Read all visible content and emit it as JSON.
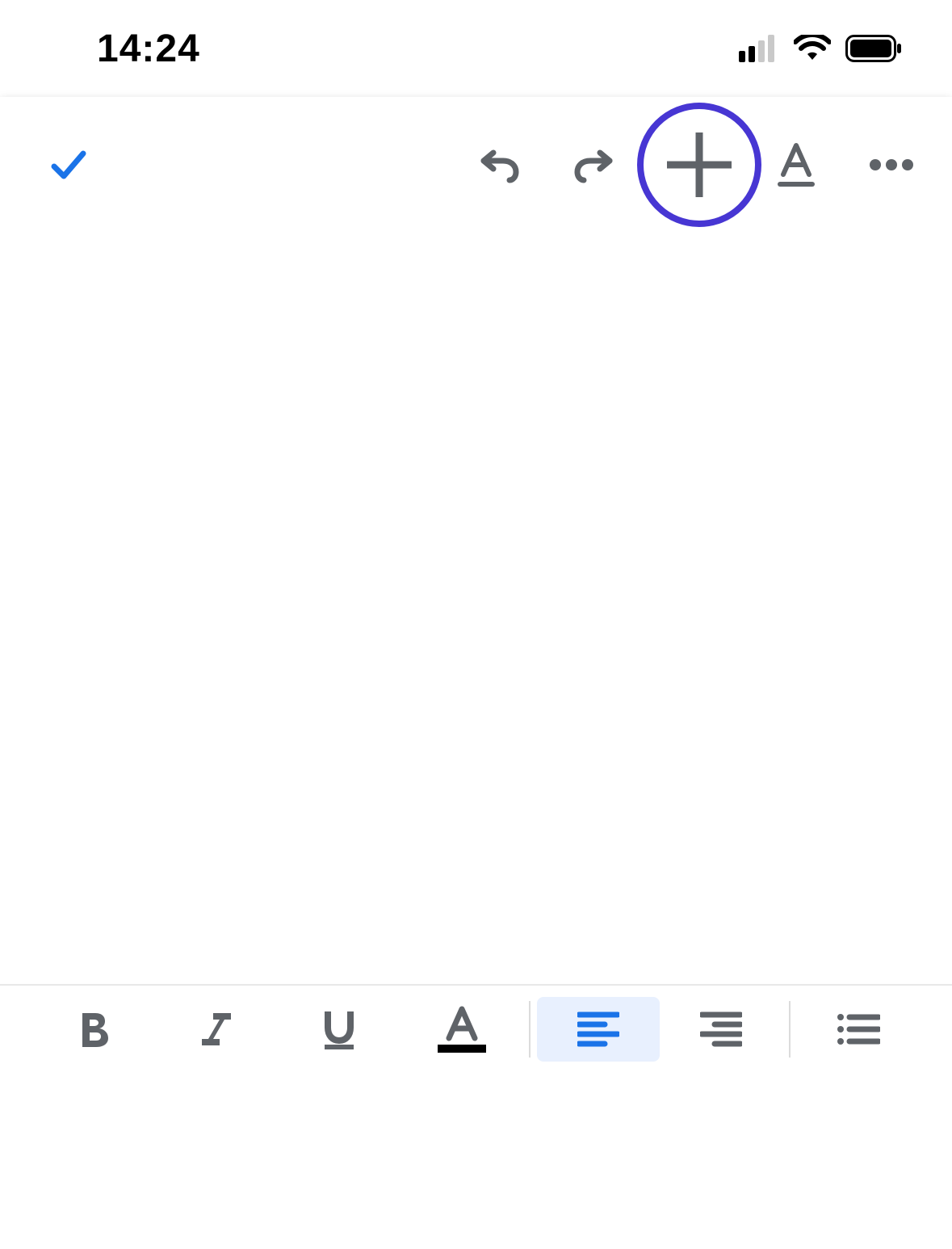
{
  "status": {
    "time": "14:24",
    "cellular_bars_active": 2,
    "cellular_bars_total": 4,
    "wifi_icon": "wifi-icon",
    "battery_icon": "battery-full-icon"
  },
  "top_toolbar": {
    "done": {
      "icon": "check-icon"
    },
    "undo": {
      "icon": "undo-icon"
    },
    "redo": {
      "icon": "redo-icon"
    },
    "insert": {
      "icon": "plus-icon",
      "highlighted": true
    },
    "text_format": {
      "icon": "text-format-icon"
    },
    "more": {
      "icon": "more-horizontal-icon"
    }
  },
  "editor": {
    "content": ""
  },
  "bottom_toolbar": {
    "bold": {
      "icon": "bold-icon",
      "label": "B",
      "active": false
    },
    "italic": {
      "icon": "italic-icon",
      "label": "I",
      "active": false
    },
    "underline": {
      "icon": "underline-icon",
      "label": "U",
      "active": false
    },
    "text_color": {
      "icon": "text-color-icon",
      "label": "A",
      "underline_color": "#000000",
      "active": false
    },
    "align_left": {
      "icon": "align-left-icon",
      "active": true
    },
    "align_right": {
      "icon": "align-right-icon",
      "active": false
    },
    "bullet_list": {
      "icon": "bullet-list-icon",
      "active": false
    }
  },
  "colors": {
    "accent_blue": "#1a73e8",
    "icon_gray": "#5f6368",
    "highlight_ring": "#4736d3",
    "active_bg": "#e8f0fe"
  }
}
